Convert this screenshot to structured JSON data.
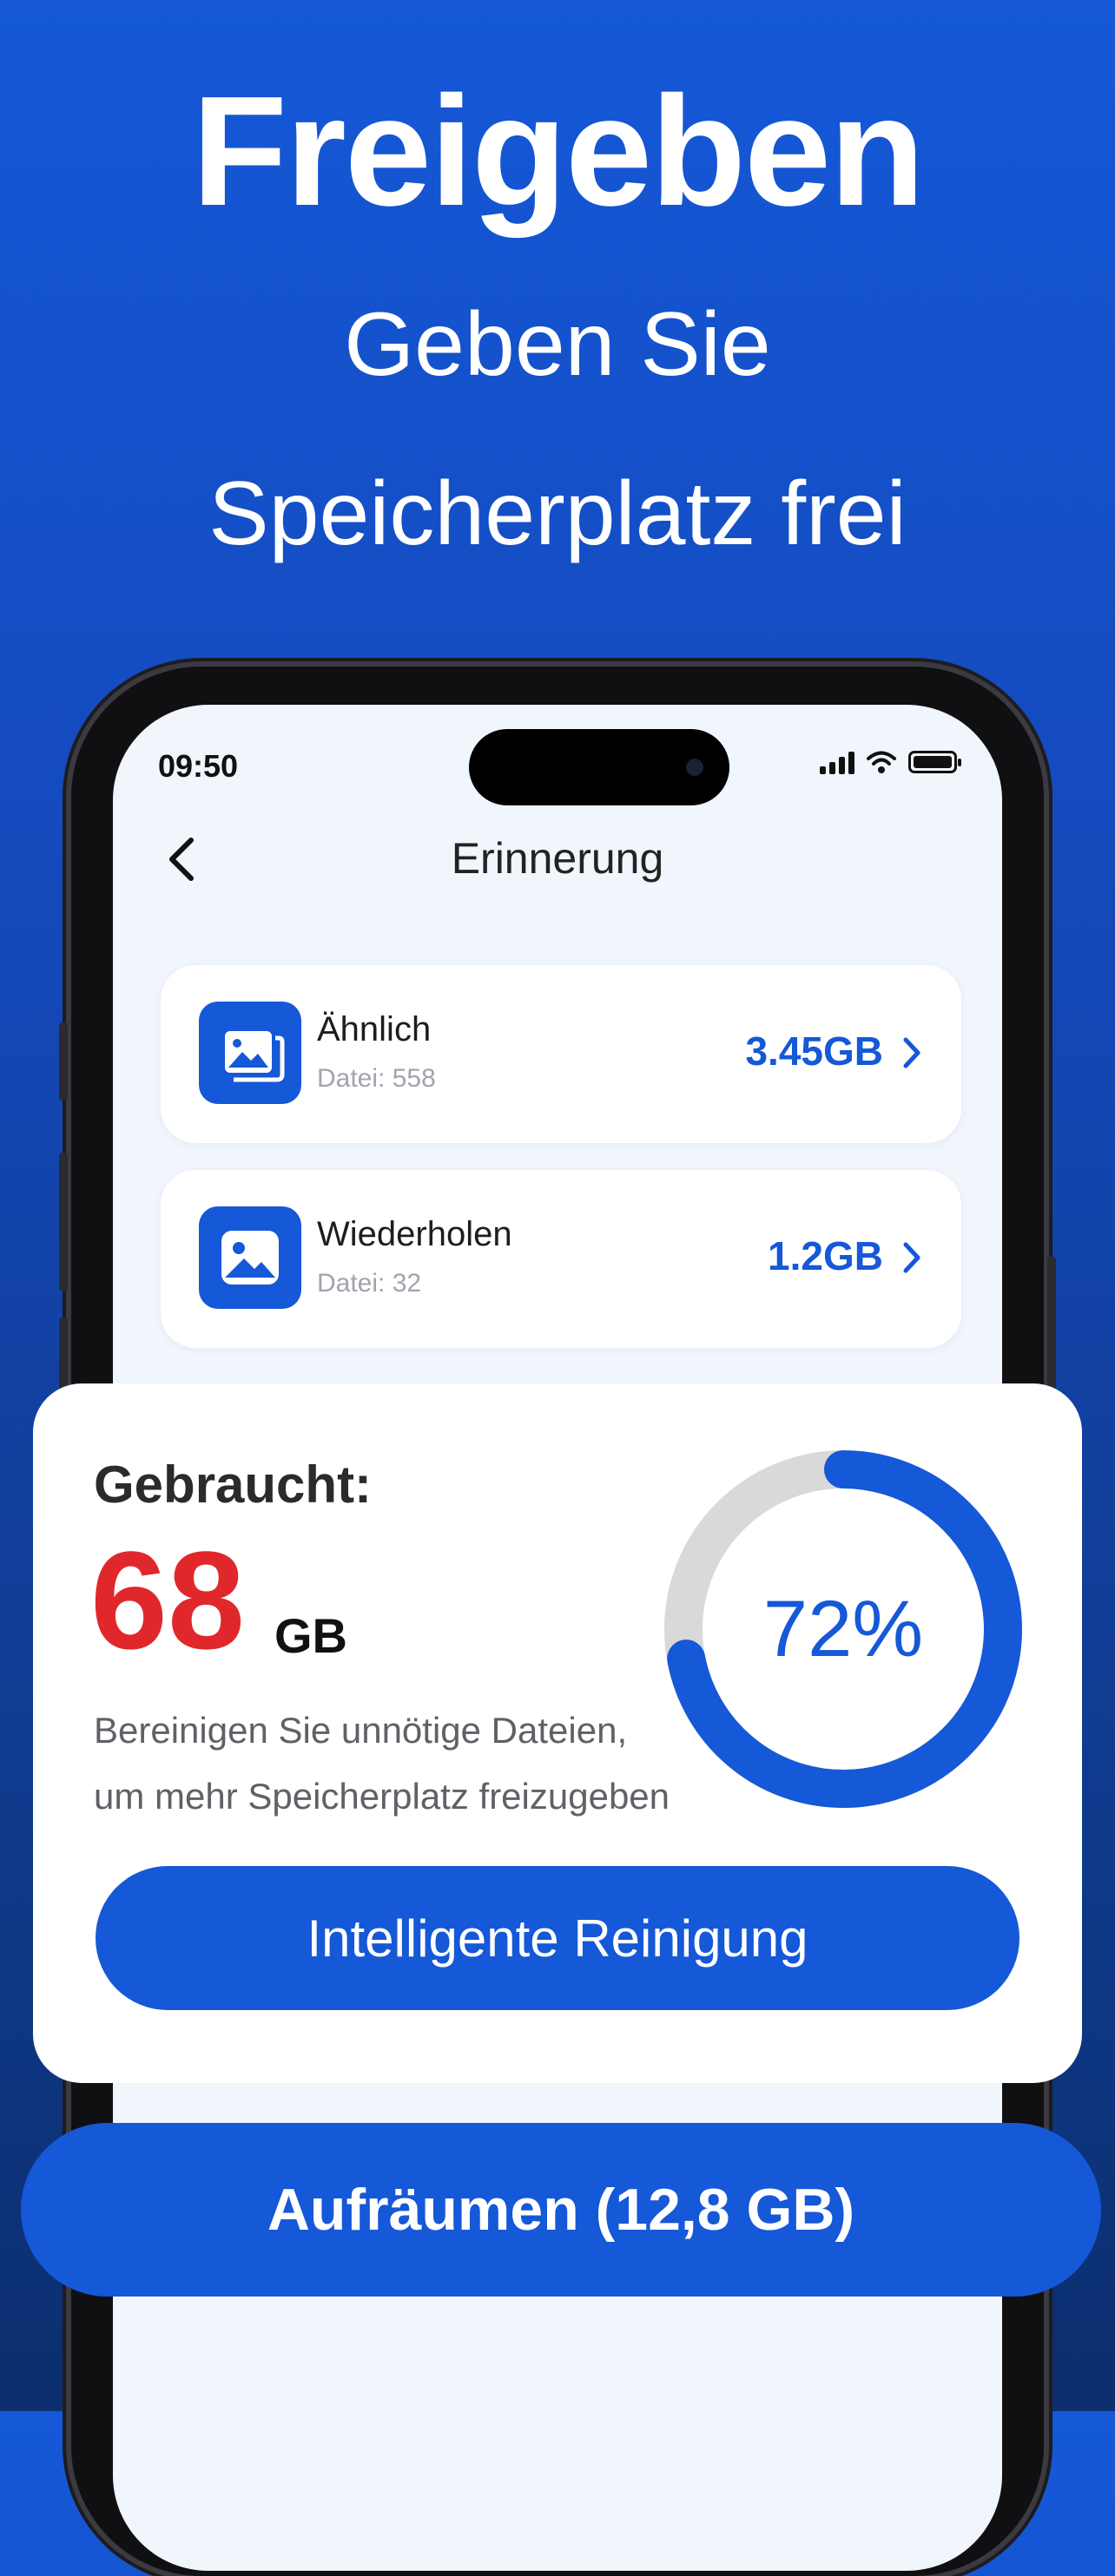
{
  "headline": {
    "title": "Freigeben",
    "line1": "Geben Sie",
    "line2": "Speicherplatz frei"
  },
  "status_bar": {
    "time": "09:50",
    "icons": [
      "signal-icon",
      "wifi-icon",
      "battery-icon"
    ]
  },
  "nav": {
    "title": "Erinnerung",
    "back_icon": "chevron-left-icon"
  },
  "items": [
    {
      "name": "Ähnlich",
      "detail": "Datei: 558",
      "size": "3.45GB",
      "icon": "photos-stack-icon"
    },
    {
      "name": "Wiederholen",
      "detail": "Datei: 32",
      "size": "1.2GB",
      "icon": "photo-icon"
    }
  ],
  "usage": {
    "label": "Gebraucht:",
    "amount": "68",
    "unit": "GB",
    "description_line1": "Bereinigen Sie unnötige Dateien,",
    "description_line2": "um mehr Speicherplatz freizugeben",
    "percent_text": "72%",
    "percent_value": 0.72,
    "button_label": "Intelligente Reinigung"
  },
  "cta": {
    "label": "Aufräumen (12,8 GB)"
  },
  "colors": {
    "accent": "#1558d8",
    "danger": "#e0282c",
    "ring_track": "#d9d9d9"
  }
}
